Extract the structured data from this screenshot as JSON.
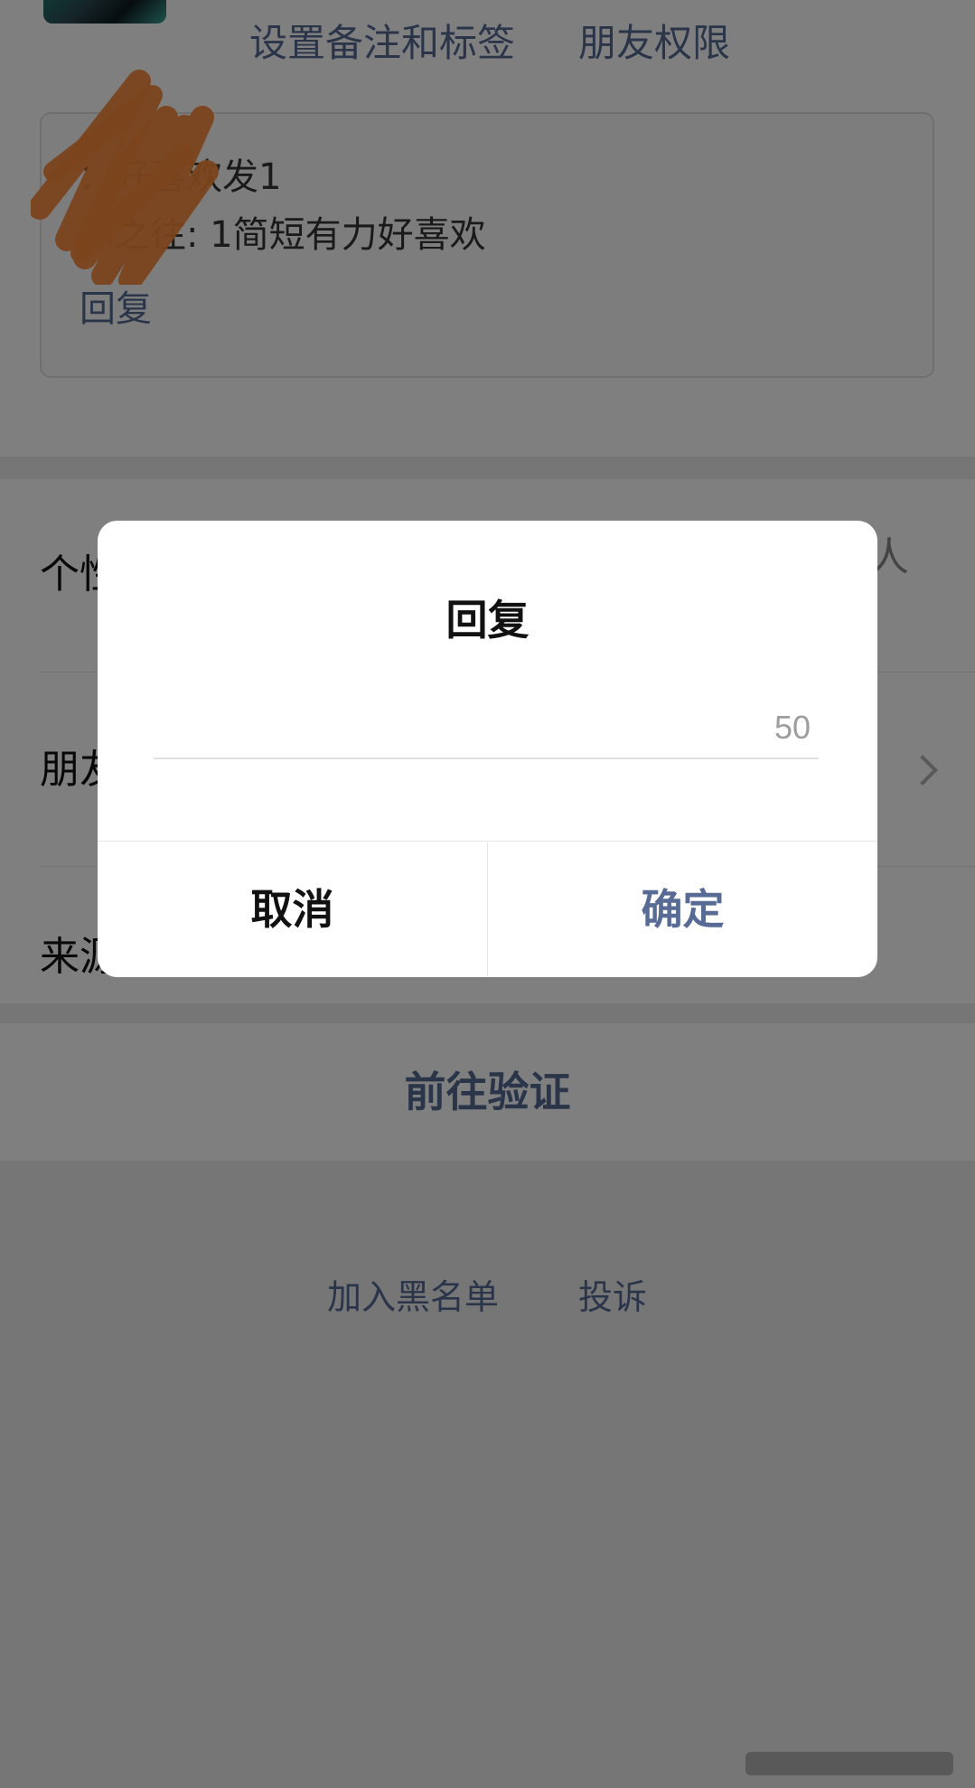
{
  "header": {
    "remark_label": "设置备注和标签",
    "permission_label": "朋友权限"
  },
  "verify_message": {
    "line1": "：好喜欢发1",
    "line2": "你之往: 1简短有力好喜欢",
    "reply_label": "回复"
  },
  "list": {
    "items": [
      {
        "label": "个性"
      },
      {
        "label": "朋友"
      },
      {
        "label": "来源"
      }
    ],
    "row1_right_glyph": "人"
  },
  "verify_button": {
    "label": "前往验证"
  },
  "footer": {
    "blacklist_label": "加入黑名单",
    "report_label": "投诉"
  },
  "dialog": {
    "title": "回复",
    "input_value": "",
    "char_counter": "50",
    "cancel_label": "取消",
    "confirm_label": "确定"
  },
  "colors": {
    "link": "#576b95",
    "scribble": "#f5893a",
    "overlay": "rgba(0,0,0,0.5)"
  },
  "icons": {
    "chevron": "chevron-right-icon"
  }
}
